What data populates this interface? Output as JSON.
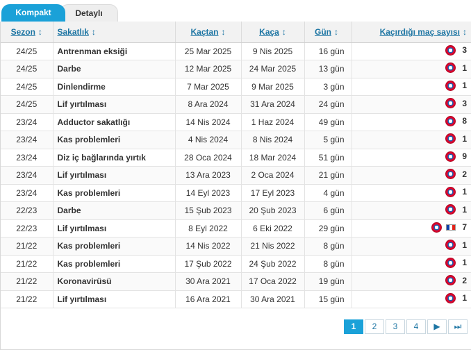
{
  "tabs": [
    {
      "label": "Kompakt",
      "active": true
    },
    {
      "label": "Detaylı",
      "active": false
    }
  ],
  "table": {
    "columns": {
      "season": "Sezon",
      "injury": "Sakatlık",
      "from": "Kaçtan",
      "to": "Kaça",
      "days": "Gün",
      "missed": "Kaçırdığı maç sayısı"
    },
    "sort_icon": "↕",
    "rows": [
      {
        "season": "24/25",
        "injury": "Antrenman eksiği",
        "from": "25 Mar 2025",
        "to": "9 Nis 2025",
        "days": "16 gün",
        "missed": "3",
        "icons": [
          "club-crest"
        ]
      },
      {
        "season": "24/25",
        "injury": "Darbe",
        "from": "12 Mar 2025",
        "to": "24 Mar 2025",
        "days": "13 gün",
        "missed": "1",
        "icons": [
          "club-crest"
        ]
      },
      {
        "season": "24/25",
        "injury": "Dinlendirme",
        "from": "7 Mar 2025",
        "to": "9 Mar 2025",
        "days": "3 gün",
        "missed": "1",
        "icons": [
          "club-crest"
        ]
      },
      {
        "season": "24/25",
        "injury": "Lif yırtılması",
        "from": "8 Ara 2024",
        "to": "31 Ara 2024",
        "days": "24 gün",
        "missed": "3",
        "icons": [
          "club-crest"
        ]
      },
      {
        "season": "23/24",
        "injury": "Adductor sakatlığı",
        "from": "14 Nis 2024",
        "to": "1 Haz 2024",
        "days": "49 gün",
        "missed": "8",
        "icons": [
          "club-crest"
        ]
      },
      {
        "season": "23/24",
        "injury": "Kas problemleri",
        "from": "4 Nis 2024",
        "to": "8 Nis 2024",
        "days": "5 gün",
        "missed": "1",
        "icons": [
          "club-crest"
        ]
      },
      {
        "season": "23/24",
        "injury": "Diz iç bağlarında yırtık",
        "from": "28 Oca 2024",
        "to": "18 Mar 2024",
        "days": "51 gün",
        "missed": "9",
        "icons": [
          "club-crest"
        ]
      },
      {
        "season": "23/24",
        "injury": "Lif yırtılması",
        "from": "13 Ara 2023",
        "to": "2 Oca 2024",
        "days": "21 gün",
        "missed": "2",
        "icons": [
          "club-crest"
        ]
      },
      {
        "season": "23/24",
        "injury": "Kas problemleri",
        "from": "14 Eyl 2023",
        "to": "17 Eyl 2023",
        "days": "4 gün",
        "missed": "1",
        "icons": [
          "club-crest"
        ]
      },
      {
        "season": "22/23",
        "injury": "Darbe",
        "from": "15 Şub 2023",
        "to": "20 Şub 2023",
        "days": "6 gün",
        "missed": "1",
        "icons": [
          "club-crest"
        ]
      },
      {
        "season": "22/23",
        "injury": "Lif yırtılması",
        "from": "8 Eyl 2022",
        "to": "6 Eki 2022",
        "days": "29 gün",
        "missed": "7",
        "icons": [
          "club-crest",
          "france-flag"
        ]
      },
      {
        "season": "21/22",
        "injury": "Kas problemleri",
        "from": "14 Nis 2022",
        "to": "21 Nis 2022",
        "days": "8 gün",
        "missed": "1",
        "icons": [
          "club-crest"
        ]
      },
      {
        "season": "21/22",
        "injury": "Kas problemleri",
        "from": "17 Şub 2022",
        "to": "24 Şub 2022",
        "days": "8 gün",
        "missed": "1",
        "icons": [
          "club-crest"
        ]
      },
      {
        "season": "21/22",
        "injury": "Koronavirüsü",
        "from": "30 Ara 2021",
        "to": "17 Oca 2022",
        "days": "19 gün",
        "missed": "2",
        "icons": [
          "club-crest"
        ]
      },
      {
        "season": "21/22",
        "injury": "Lif yırtılması",
        "from": "16 Ara 2021",
        "to": "30 Ara 2021",
        "days": "15 gün",
        "missed": "1",
        "icons": [
          "club-crest"
        ]
      }
    ]
  },
  "pagination": {
    "pages": [
      "1",
      "2",
      "3",
      "4"
    ],
    "current": "1",
    "next_label": "▶",
    "last_label": "⏭",
    "next_icon": "next-page-icon",
    "last_icon": "last-page-icon"
  },
  "colors": {
    "accent": "#1aa1d8",
    "link": "#1d75a3",
    "header_bg": "#f2f2f2"
  }
}
